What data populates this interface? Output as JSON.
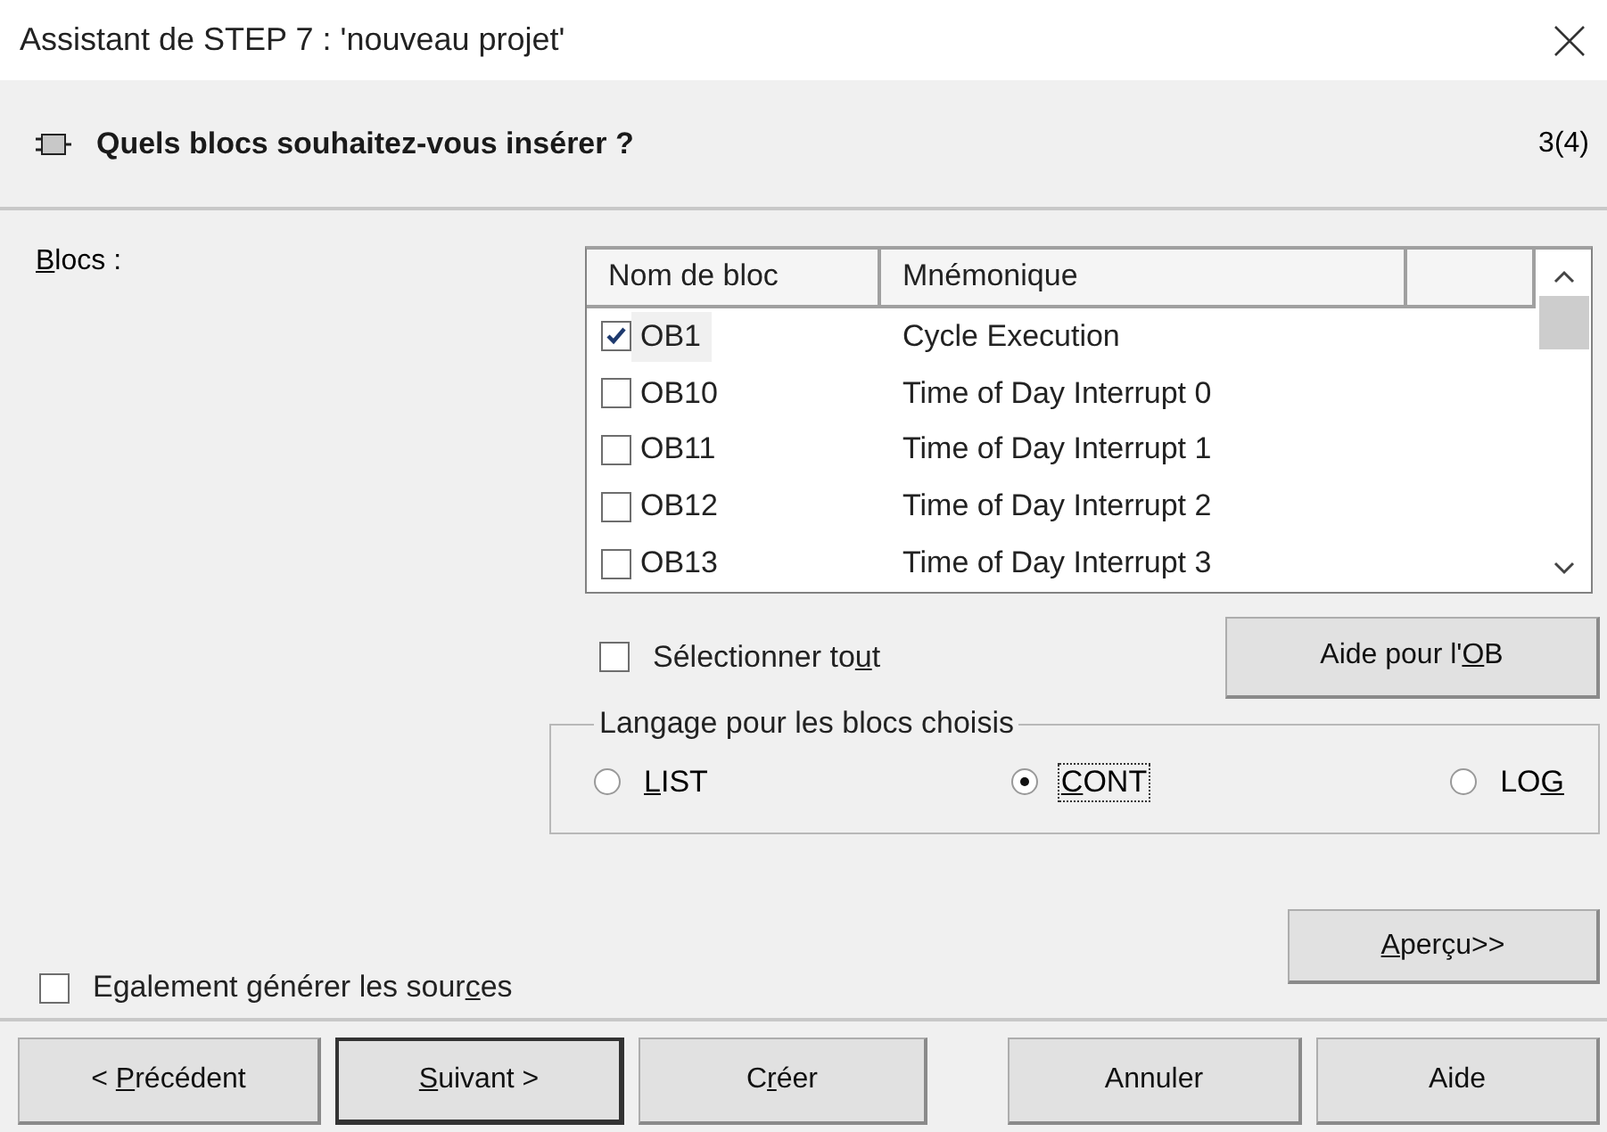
{
  "window": {
    "title": "Assistant de STEP 7 : 'nouveau projet'"
  },
  "header": {
    "title": "Quels blocs souhaitez-vous insérer ?",
    "step": "3(4)"
  },
  "blocks_label": {
    "key": "B",
    "post": "locs :"
  },
  "table": {
    "columns": [
      "Nom de bloc",
      "Mnémonique"
    ],
    "rows": [
      {
        "name": "OB1",
        "mnemonic": "Cycle Execution",
        "checked": true,
        "selected": true
      },
      {
        "name": "OB10",
        "mnemonic": "Time of Day Interrupt 0",
        "checked": false,
        "selected": false
      },
      {
        "name": "OB11",
        "mnemonic": "Time of Day Interrupt 1",
        "checked": false,
        "selected": false
      },
      {
        "name": "OB12",
        "mnemonic": "Time of Day Interrupt 2",
        "checked": false,
        "selected": false
      },
      {
        "name": "OB13",
        "mnemonic": "Time of Day Interrupt 3",
        "checked": false,
        "selected": false
      }
    ]
  },
  "select_all": {
    "label": {
      "pre": "Sélectionner to",
      "key": "u",
      "post": "t"
    },
    "checked": false
  },
  "ob_help_button": {
    "label": {
      "pre": "Aide pour l'",
      "key": "O",
      "post": "B"
    }
  },
  "language_group": {
    "title": "Langage pour les blocs choisis",
    "options": [
      {
        "label": {
          "key": "L",
          "post": "IST"
        },
        "selected": false
      },
      {
        "label": {
          "key": "C",
          "post": "ONT"
        },
        "selected": true
      },
      {
        "label": {
          "pre": "LO",
          "key": "G"
        },
        "selected": false
      }
    ]
  },
  "generate_sources": {
    "label": {
      "pre": "Egalement générer les sour",
      "key": "c",
      "post": "es"
    },
    "checked": false
  },
  "preview_button": {
    "label": {
      "key": "A",
      "post": "perçu>>"
    }
  },
  "buttons": [
    {
      "label": {
        "pre": "< ",
        "key": "P",
        "post": "récédent"
      },
      "default": false
    },
    {
      "label": {
        "key": "S",
        "post": "uivant >"
      },
      "default": true
    },
    {
      "label": {
        "pre": "C",
        "key": "r",
        "post": "éer"
      },
      "default": false
    },
    {
      "label": "Annuler",
      "default": false
    },
    {
      "label": "Aide",
      "default": false
    }
  ]
}
